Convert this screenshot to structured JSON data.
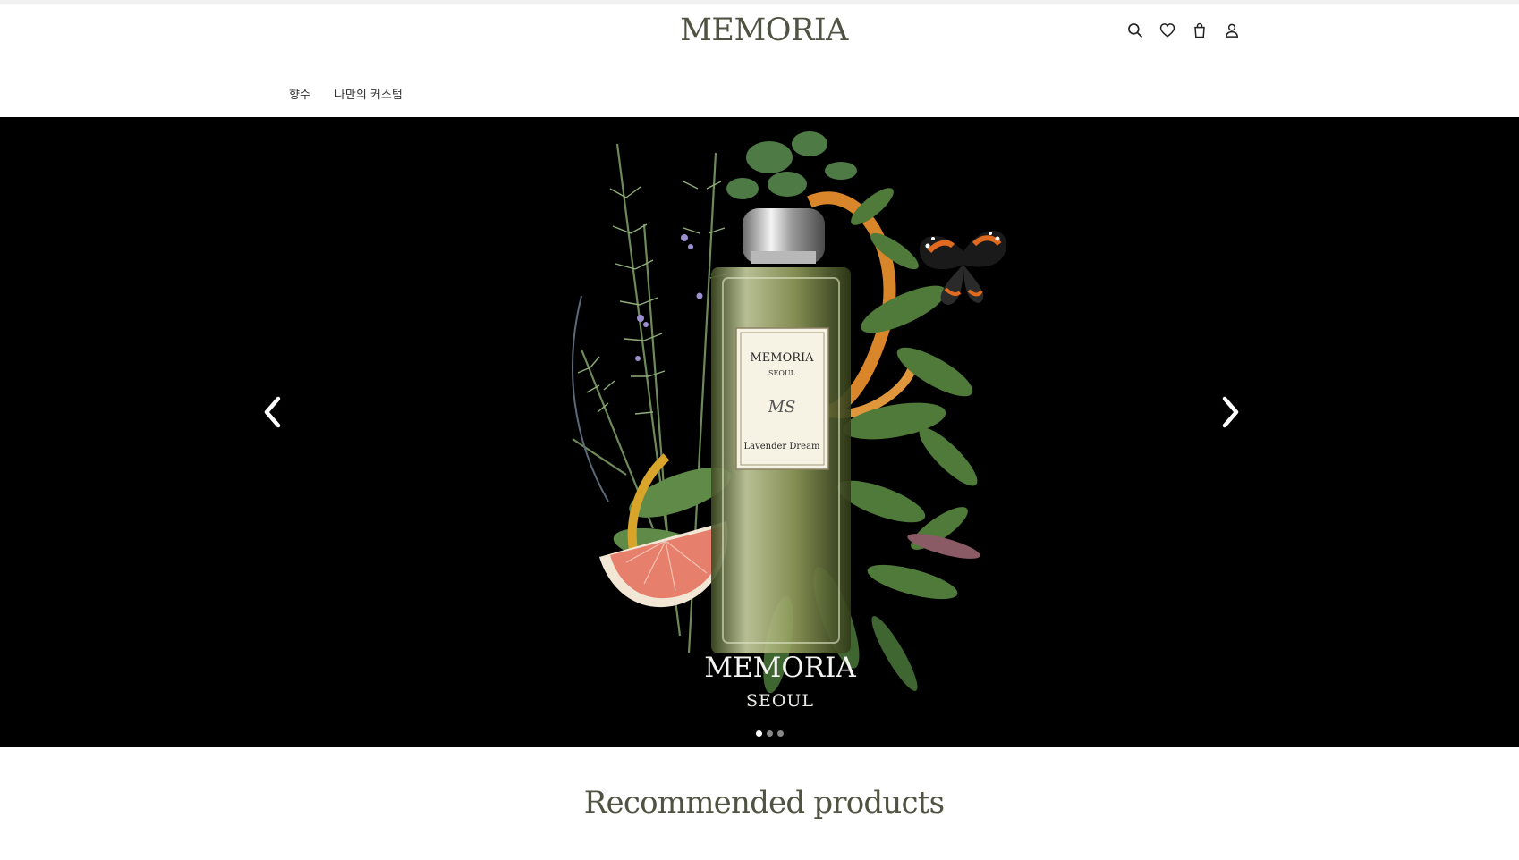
{
  "header": {
    "logo": "MEMORIA",
    "icons": [
      "search-icon",
      "heart-icon",
      "bag-icon",
      "user-icon"
    ]
  },
  "nav": {
    "items": [
      "향수",
      "나만의 커스텀"
    ]
  },
  "hero": {
    "bottle_brand": "MEMORIA",
    "bottle_city": "SEOUL",
    "bottle_monogram": "MS",
    "bottle_name": "Lavender Dream",
    "brand": "MEMORIA",
    "sub": "SEOUL",
    "slides_total": 3,
    "slide_active": 1
  },
  "recommended": {
    "title": "Recommended products"
  },
  "colors": {
    "logo": "#4f5342",
    "hero_bg": "#000000"
  }
}
